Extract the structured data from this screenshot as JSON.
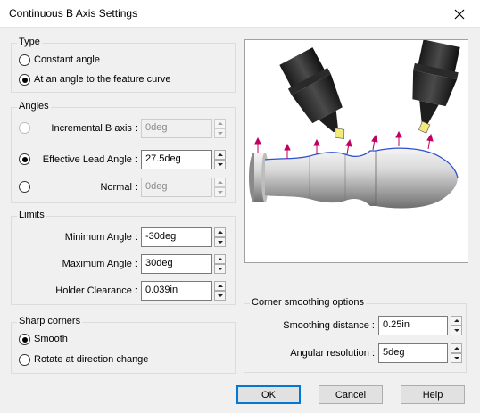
{
  "window": {
    "title": "Continuous B Axis Settings"
  },
  "type_group": {
    "title": "Type",
    "options": [
      "Constant angle",
      "At an angle to the feature curve"
    ],
    "selected": 1
  },
  "angles_group": {
    "title": "Angles",
    "incremental": {
      "label": "Incremental B axis :",
      "value": "0deg"
    },
    "effective": {
      "label": "Effective Lead Angle :",
      "value": "27.5deg"
    },
    "normal": {
      "label": "Normal :",
      "value": "0deg"
    }
  },
  "limits_group": {
    "title": "Limits",
    "min": {
      "label": "Minimum Angle :",
      "value": "-30deg"
    },
    "max": {
      "label": "Maximum Angle :",
      "value": "30deg"
    },
    "holder": {
      "label": "Holder Clearance :",
      "value": "0.039in"
    }
  },
  "sharp_group": {
    "title": "Sharp corners",
    "options": [
      "Smooth",
      "Rotate at direction change"
    ],
    "selected": 0
  },
  "corner_group": {
    "title": "Corner smoothing options",
    "distance": {
      "label": "Smoothing distance :",
      "value": "0.25in"
    },
    "resolution": {
      "label": "Angular resolution :",
      "value": "5deg"
    }
  },
  "buttons": {
    "ok": "OK",
    "cancel": "Cancel",
    "help": "Help"
  },
  "colors": {
    "arrow": "#c00060",
    "curve": "#3050d0",
    "insert": "#f2ea7a",
    "default_button_border": "#0078d7"
  }
}
